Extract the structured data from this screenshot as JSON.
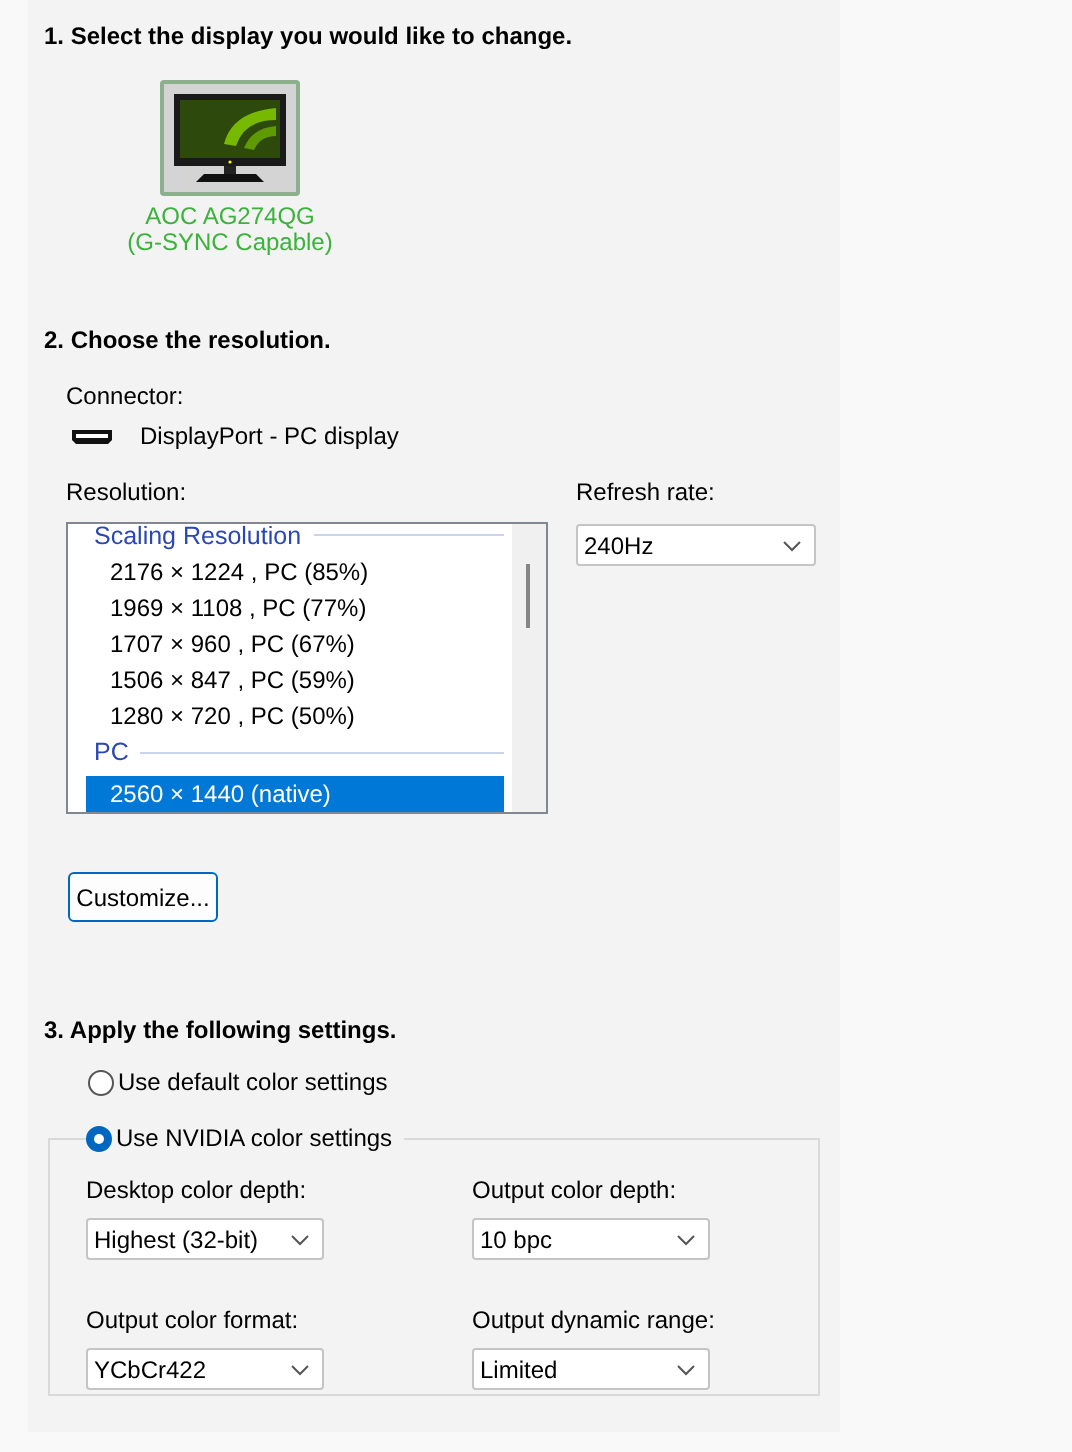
{
  "step1": {
    "heading": "1. Select the display you would like to change.",
    "displays": [
      {
        "name": "AOC AG274QG",
        "subtitle": "(G-SYNC Capable)",
        "selected": true
      }
    ]
  },
  "step2": {
    "heading": "2. Choose the resolution.",
    "connector_label": "Connector:",
    "connector": "DisplayPort - PC display",
    "resolution_label": "Resolution:",
    "resolutions": [
      {
        "kind": "group",
        "label": "Scaling Resolution"
      },
      {
        "kind": "item",
        "label": "2176 × 1224 , PC (85%)",
        "selected": false
      },
      {
        "kind": "item",
        "label": "1969 × 1108 , PC (77%)",
        "selected": false
      },
      {
        "kind": "item",
        "label": "1707 × 960 , PC (67%)",
        "selected": false
      },
      {
        "kind": "item",
        "label": "1506 × 847 , PC (59%)",
        "selected": false
      },
      {
        "kind": "item",
        "label": "1280 × 720 , PC (50%)",
        "selected": false
      },
      {
        "kind": "group",
        "label": "PC"
      },
      {
        "kind": "item",
        "label": "2560 × 1440 (native)",
        "selected": true
      }
    ],
    "refresh_label": "Refresh rate:",
    "refresh_rate": "240Hz",
    "customize_button": "Customize..."
  },
  "step3": {
    "heading": "3. Apply the following settings.",
    "options": [
      {
        "label": "Use default color settings",
        "selected": false
      },
      {
        "label": "Use NVIDIA color settings",
        "selected": true
      }
    ],
    "fields": [
      {
        "label": "Desktop color depth:",
        "value": "Highest (32-bit)"
      },
      {
        "label": "Output color depth:",
        "value": "10 bpc"
      },
      {
        "label": "Output color format:",
        "value": "YCbCr422"
      },
      {
        "label": "Output dynamic range:",
        "value": "Limited"
      }
    ]
  }
}
